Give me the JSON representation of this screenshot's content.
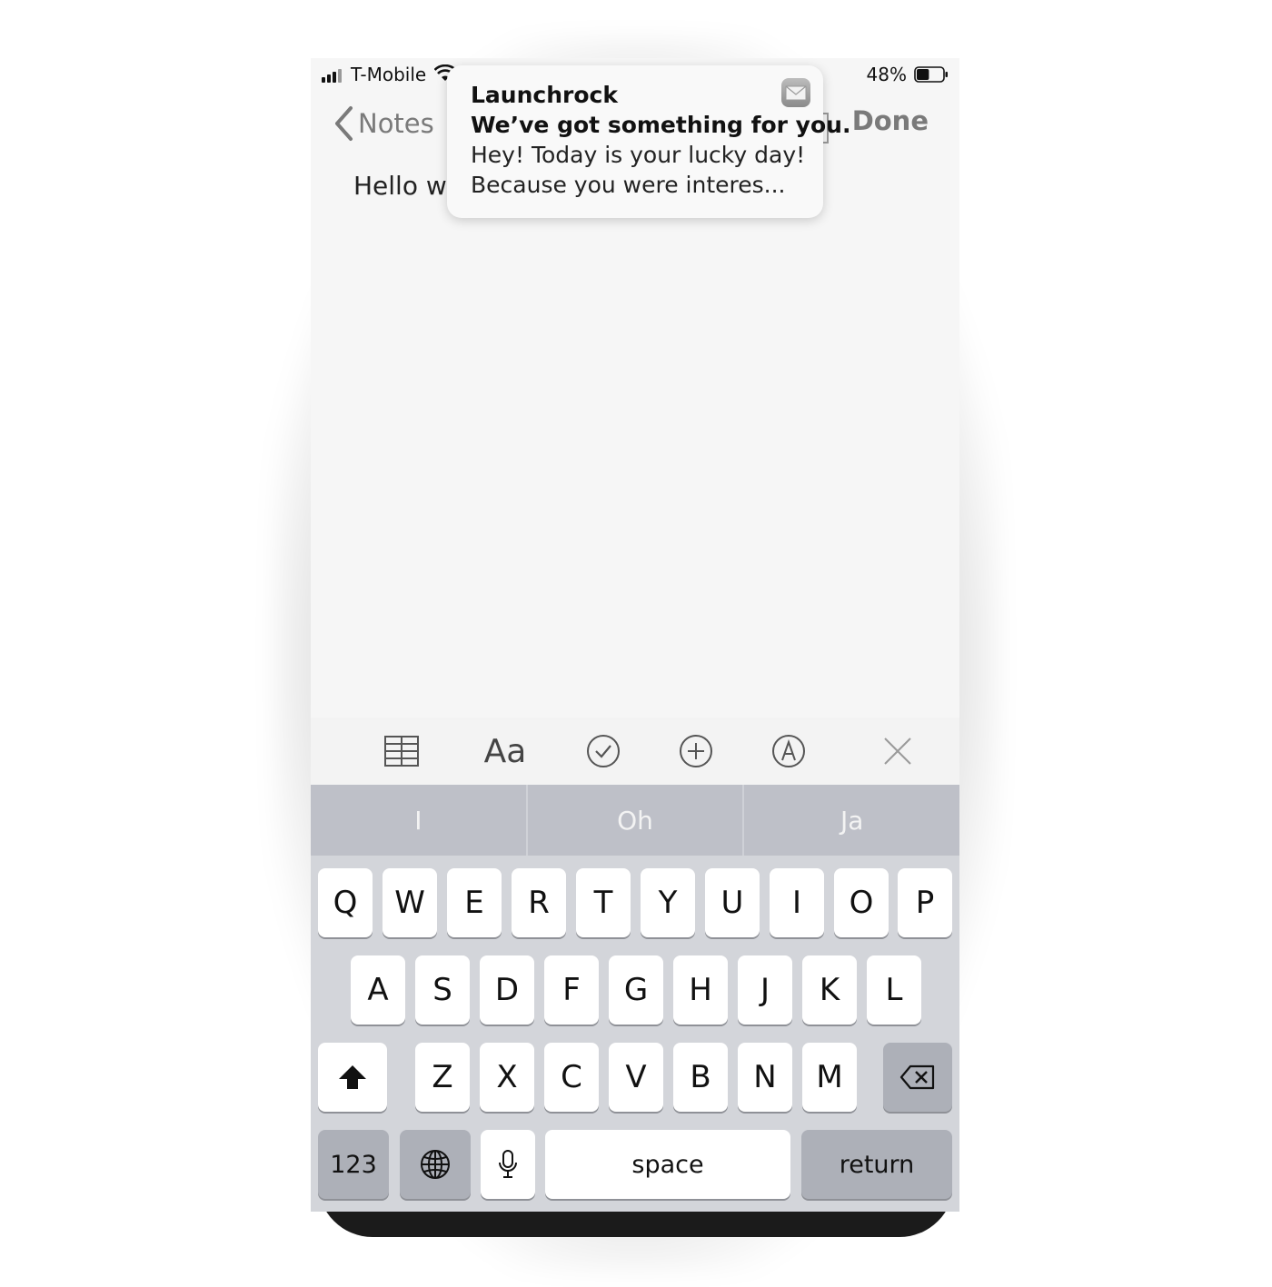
{
  "status_bar": {
    "carrier": "T-Mobile",
    "battery_percent": "48%",
    "battery_level": 0.48
  },
  "nav": {
    "back_label": "Notes",
    "done_label": "Done"
  },
  "note": {
    "text": "Hello wo"
  },
  "notification": {
    "app_name": "Launchrock",
    "title": "We’ve got something for you.",
    "body_line1": "Hey! Today is your lucky day!",
    "body_line2": "Because you were interes..."
  },
  "toolbar": {
    "icons": [
      "table-icon",
      "format-text-icon",
      "checklist-icon",
      "add-icon",
      "markup-icon",
      "close-icon"
    ],
    "format_label": "Aa"
  },
  "suggestions": [
    "I",
    "Oh",
    "Ja"
  ],
  "keyboard": {
    "row1": [
      "Q",
      "W",
      "E",
      "R",
      "T",
      "Y",
      "U",
      "I",
      "O",
      "P"
    ],
    "row2": [
      "A",
      "S",
      "D",
      "F",
      "G",
      "H",
      "J",
      "K",
      "L"
    ],
    "row3": [
      "Z",
      "X",
      "C",
      "V",
      "B",
      "N",
      "M"
    ],
    "numbers_label": "123",
    "space_label": "space",
    "return_label": "return"
  }
}
